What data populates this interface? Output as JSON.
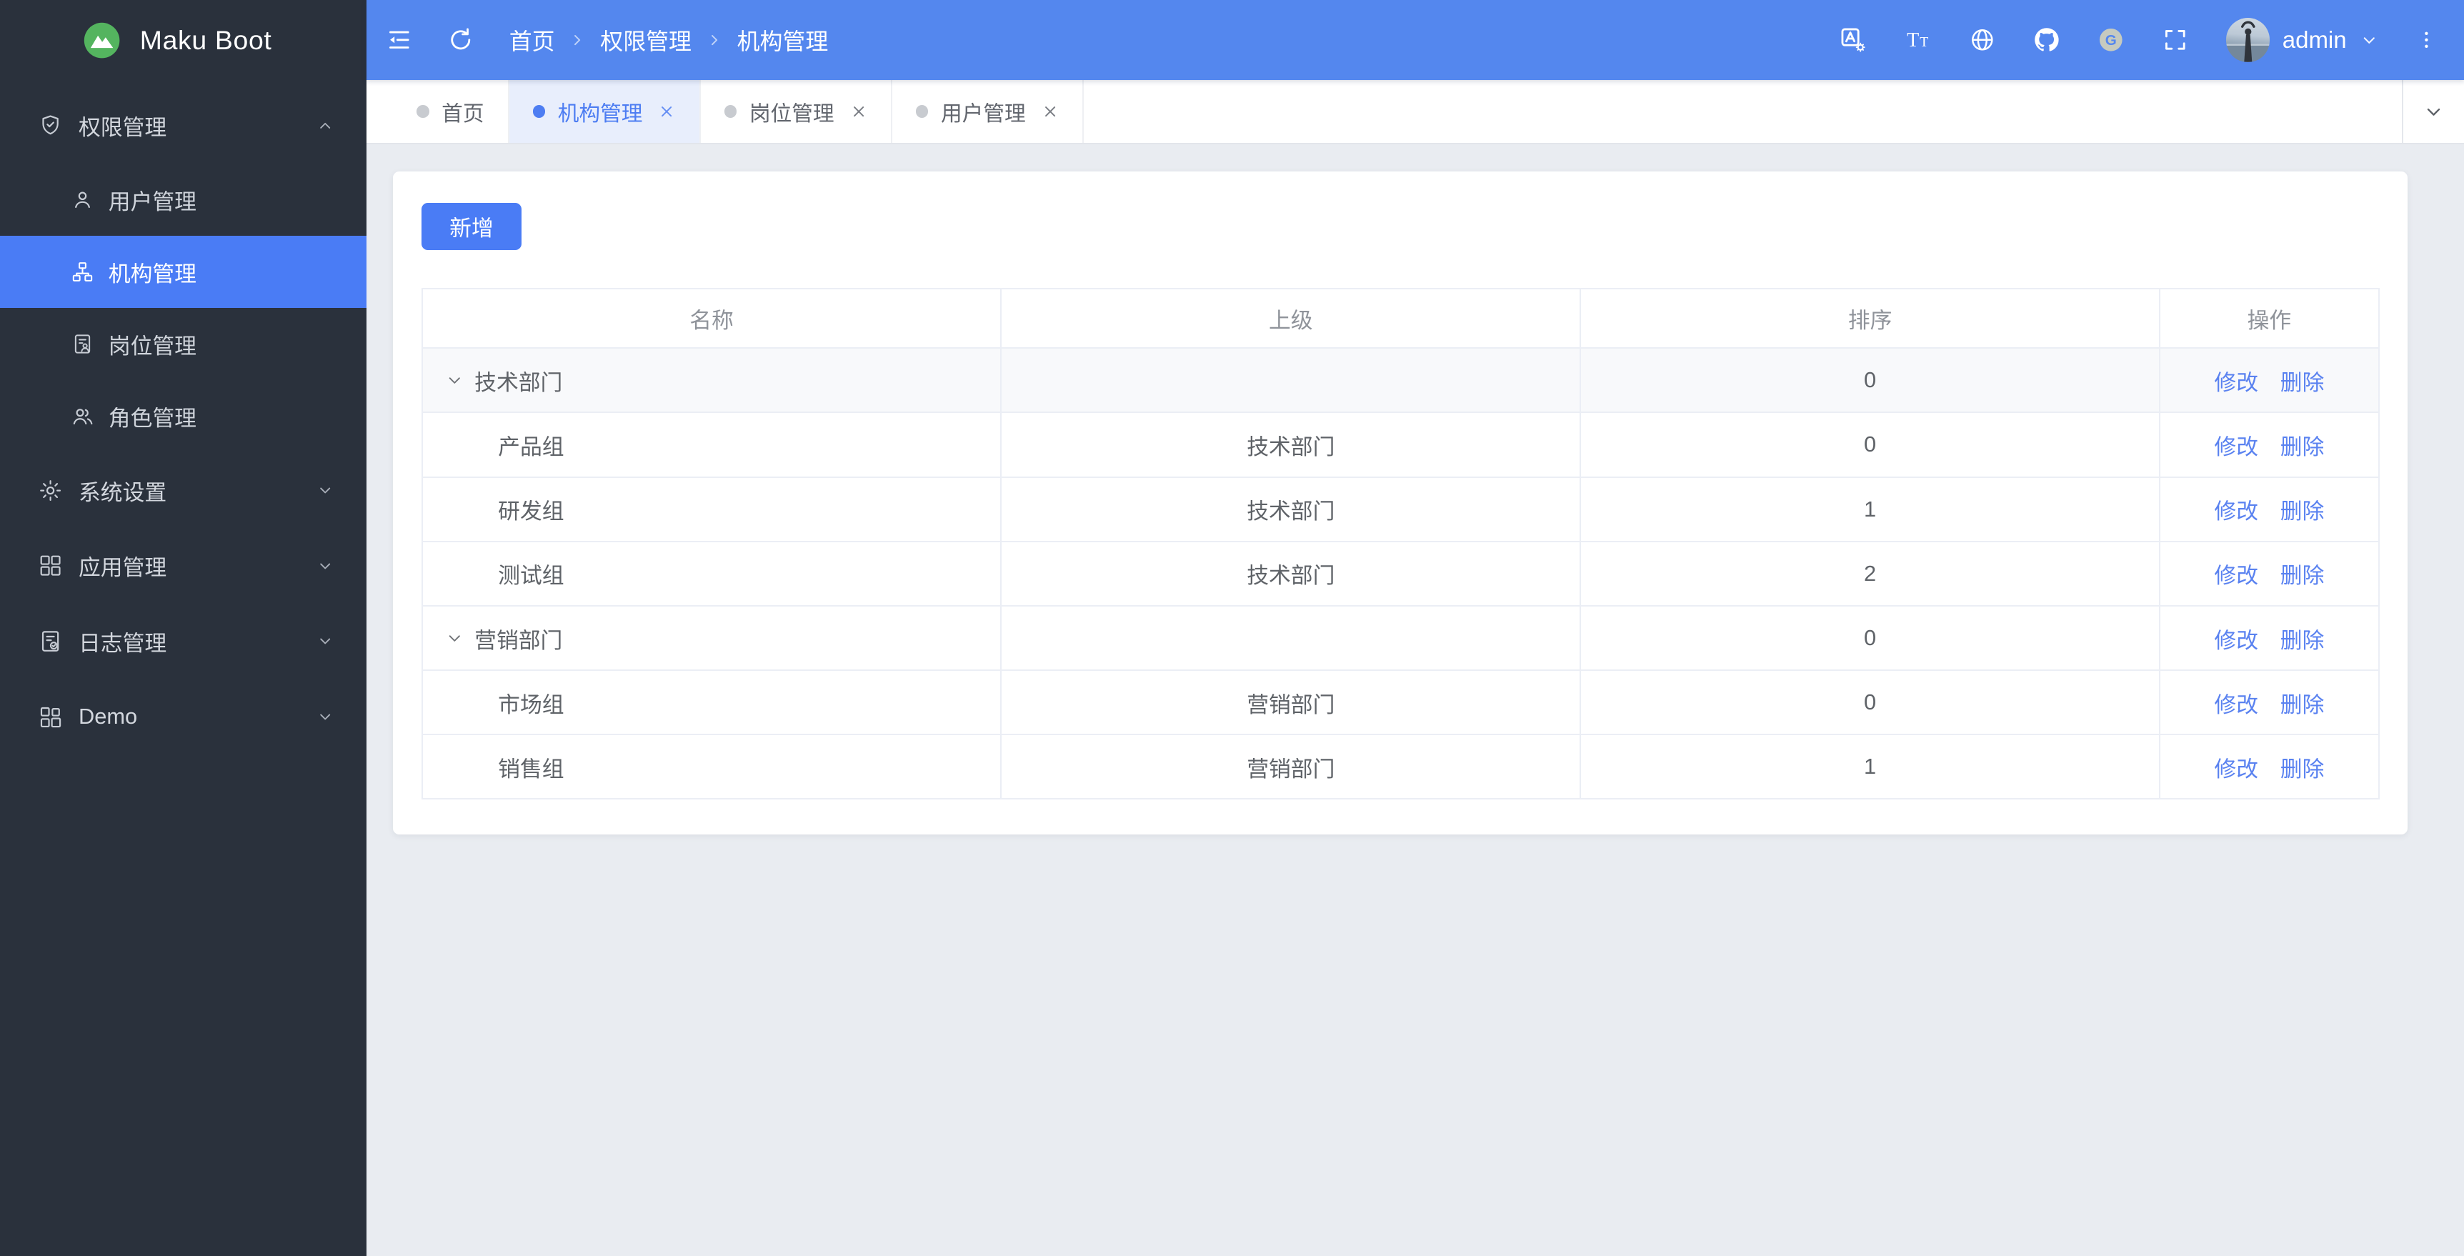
{
  "app": {
    "title": "Maku Boot",
    "logo_icon": "mountain-logo-icon"
  },
  "colors": {
    "topbar_bg": "#5487ee",
    "primary": "#4a7cf5",
    "sidebar_bg": "#2a313c",
    "active_tab_bg": "#e8eefc",
    "link_blue": "#5a82f0",
    "logo_green": "#54b45f"
  },
  "sidebar": {
    "groups": [
      {
        "id": "permission-management",
        "label": "权限管理",
        "icon": "shield-check-icon",
        "expanded": true,
        "children": [
          {
            "id": "user-management",
            "label": "用户管理",
            "icon": "user-icon",
            "active": false
          },
          {
            "id": "org-management",
            "label": "机构管理",
            "icon": "org-tree-icon",
            "active": true
          },
          {
            "id": "post-management",
            "label": "岗位管理",
            "icon": "post-doc-icon",
            "active": false
          },
          {
            "id": "role-management",
            "label": "角色管理",
            "icon": "roles-icon",
            "active": false
          }
        ]
      },
      {
        "id": "system-settings",
        "label": "系统设置",
        "icon": "gear-icon",
        "expanded": false,
        "children": []
      },
      {
        "id": "app-management",
        "label": "应用管理",
        "icon": "grid-icon",
        "expanded": false,
        "children": []
      },
      {
        "id": "log-management",
        "label": "日志管理",
        "icon": "log-doc-icon",
        "expanded": false,
        "children": []
      },
      {
        "id": "demo",
        "label": "Demo",
        "icon": "demo-icon",
        "expanded": false,
        "children": []
      }
    ]
  },
  "header": {
    "left_icons": [
      "menu-fold-icon",
      "refresh-icon"
    ],
    "breadcrumb": [
      "首页",
      "权限管理",
      "机构管理"
    ],
    "breadcrumb_separator_icon": "chevron-right-icon",
    "right_icons": [
      "translate-icon",
      "font-size-icon",
      "globe-icon",
      "github-icon",
      "gitee-icon",
      "fullscreen-icon"
    ],
    "user": {
      "name": "admin",
      "avatar_icon": "avatar-photo",
      "menu_icon": "chevron-down-icon"
    },
    "more_icon": "kebab-icon"
  },
  "tabs_bar": {
    "tabs": [
      {
        "id": "home",
        "label": "首页",
        "active": false,
        "closable": false
      },
      {
        "id": "org-management",
        "label": "机构管理",
        "active": true,
        "closable": true
      },
      {
        "id": "post-management",
        "label": "岗位管理",
        "active": false,
        "closable": true
      },
      {
        "id": "user-management",
        "label": "用户管理",
        "active": false,
        "closable": true
      }
    ],
    "overflow_icon": "chevron-down-icon"
  },
  "main": {
    "add_button": "新增",
    "table": {
      "columns": [
        "名称",
        "上级",
        "排序",
        "操作"
      ],
      "actions": [
        "修改",
        "删除"
      ],
      "action_ids": [
        "edit",
        "delete"
      ],
      "rows": [
        {
          "name": "技术部门",
          "parent": "",
          "sort": "0",
          "level": 0,
          "expandable": true,
          "hovered": true
        },
        {
          "name": "产品组",
          "parent": "技术部门",
          "sort": "0",
          "level": 1,
          "expandable": false,
          "hovered": false
        },
        {
          "name": "研发组",
          "parent": "技术部门",
          "sort": "1",
          "level": 1,
          "expandable": false,
          "hovered": false
        },
        {
          "name": "测试组",
          "parent": "技术部门",
          "sort": "2",
          "level": 1,
          "expandable": false,
          "hovered": false
        },
        {
          "name": "营销部门",
          "parent": "",
          "sort": "0",
          "level": 0,
          "expandable": true,
          "hovered": false
        },
        {
          "name": "市场组",
          "parent": "营销部门",
          "sort": "0",
          "level": 1,
          "expandable": false,
          "hovered": false
        },
        {
          "name": "销售组",
          "parent": "营销部门",
          "sort": "1",
          "level": 1,
          "expandable": false,
          "hovered": false
        }
      ]
    }
  }
}
